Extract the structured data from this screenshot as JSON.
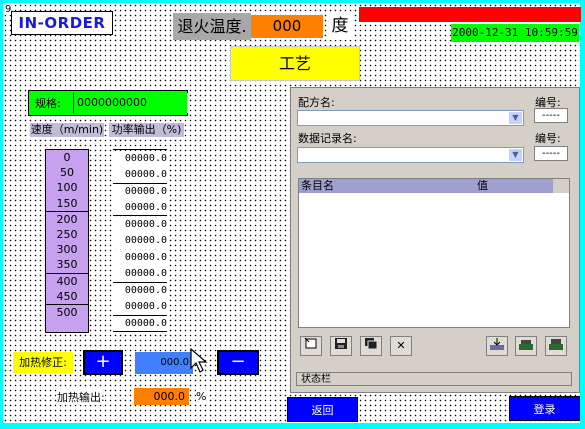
{
  "header": {
    "logo": "IN-ORDER",
    "corner_mark": "9",
    "anneal_label": "退火温度.",
    "anneal_value": "000",
    "anneal_unit": "度",
    "datetime": "2000-12-31 10:59:59",
    "process_label": "工艺"
  },
  "left": {
    "spec_label": "规格:",
    "spec_value": "0000000000",
    "speed_header": "速度（m/min)",
    "output_header": "功率输出（%)",
    "speeds": [
      "0",
      "50",
      "100",
      "150",
      "200",
      "250",
      "300",
      "350",
      "400",
      "450",
      "500"
    ],
    "outputs": [
      "00000.0",
      "00000.0",
      "00000.0",
      "00000.0",
      "00000.0",
      "00000.0",
      "00000.0",
      "00000.0",
      "00000.0",
      "00000.0",
      "00000.0"
    ],
    "heat_adjust_label": "加热修正:",
    "plus_label": "+",
    "minus_label": "−",
    "heat_adjust_value": "000.0",
    "heat_output_label": "加热输出:",
    "heat_output_value": "000.0",
    "heat_output_unit": "%"
  },
  "recipe": {
    "recipe_name_label": "配方名:",
    "recipe_no_label": "编号:",
    "recipe_no_value": "-----",
    "record_name_label": "数据记录名:",
    "record_no_label": "编号:",
    "record_no_value": "-----",
    "col_entry": "条目名",
    "col_value": "值",
    "status_label": "状态栏"
  },
  "nav": {
    "back_label": "返回",
    "login_label": "登录"
  }
}
